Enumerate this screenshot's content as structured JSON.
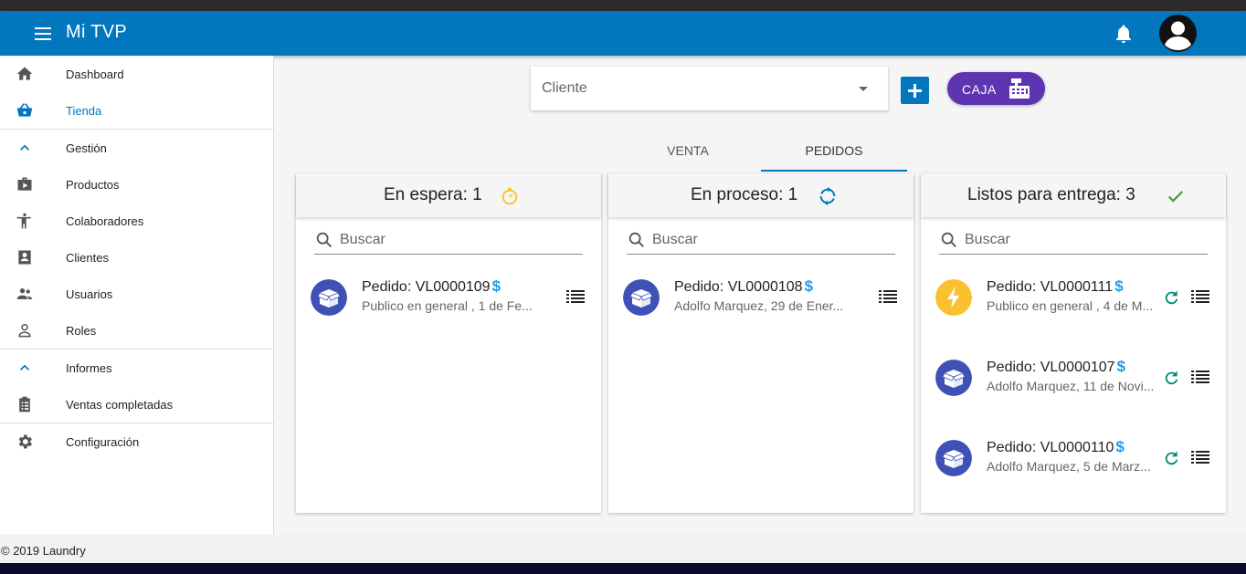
{
  "app": {
    "title": "Mi TVP"
  },
  "header": {
    "notifications_icon": "bell-icon",
    "avatar_icon": "account-circle-icon"
  },
  "sidebar": {
    "items": [
      {
        "label": "Dashboard",
        "icon": "home-icon",
        "active": false
      },
      {
        "label": "Tienda",
        "icon": "basket-icon",
        "active": true
      },
      {
        "label": "Gestión",
        "icon": "chevron-up-icon",
        "active": false
      },
      {
        "label": "Productos",
        "icon": "box-play-icon",
        "active": false
      },
      {
        "label": "Colaboradores",
        "icon": "person-standing-icon",
        "active": false
      },
      {
        "label": "Clientes",
        "icon": "contact-card-icon",
        "active": false
      },
      {
        "label": "Usuarios",
        "icon": "people-icon",
        "active": false
      },
      {
        "label": "Roles",
        "icon": "person-outline-icon",
        "active": false
      },
      {
        "label": "Informes",
        "icon": "chevron-up-icon",
        "active": false
      },
      {
        "label": "Ventas completadas",
        "icon": "clipboard-list-icon",
        "active": false
      },
      {
        "label": "Configuración",
        "icon": "gear-icon",
        "active": false
      }
    ]
  },
  "main": {
    "client_placeholder": "Cliente",
    "caja_label": "CAJA",
    "tabs": [
      {
        "label": "VENTA",
        "active": false
      },
      {
        "label": "PEDIDOS",
        "active": true
      }
    ],
    "columns": [
      {
        "title": "En espera: 1",
        "icon": "timer-icon",
        "search_placeholder": "Buscar",
        "orders": [
          {
            "title": "Pedido: VL0000109",
            "subtitle": "Publico en general , 1 de Fe...",
            "icon": "package-icon"
          }
        ]
      },
      {
        "title": "En proceso: 1",
        "icon": "sync-icon",
        "search_placeholder": "Buscar",
        "orders": [
          {
            "title": "Pedido: VL0000108",
            "subtitle": "Adolfo Marquez, 29 de Ener...",
            "icon": "package-icon"
          }
        ]
      },
      {
        "title": "Listos para entrega: 3",
        "icon": "check-icon",
        "search_placeholder": "Buscar",
        "orders": [
          {
            "title": "Pedido: VL0000111",
            "subtitle": "Publico en general , 4 de M...",
            "icon": "lightning-icon"
          },
          {
            "title": "Pedido: VL0000107",
            "subtitle": "Adolfo Marquez, 11 de Novi...",
            "icon": "package-icon"
          },
          {
            "title": "Pedido: VL0000110",
            "subtitle": "Adolfo Marquez, 5 de Marz...",
            "icon": "package-icon"
          }
        ]
      }
    ],
    "dollar_symbol": "$"
  },
  "footer": {
    "text": "© 2019 Laundry"
  },
  "colors": {
    "primary": "#0277bd",
    "caja": "#5e35b1",
    "package": "#3f51b5",
    "lightning": "#fbc02d",
    "success": "#43a047",
    "refresh": "#00897b"
  }
}
